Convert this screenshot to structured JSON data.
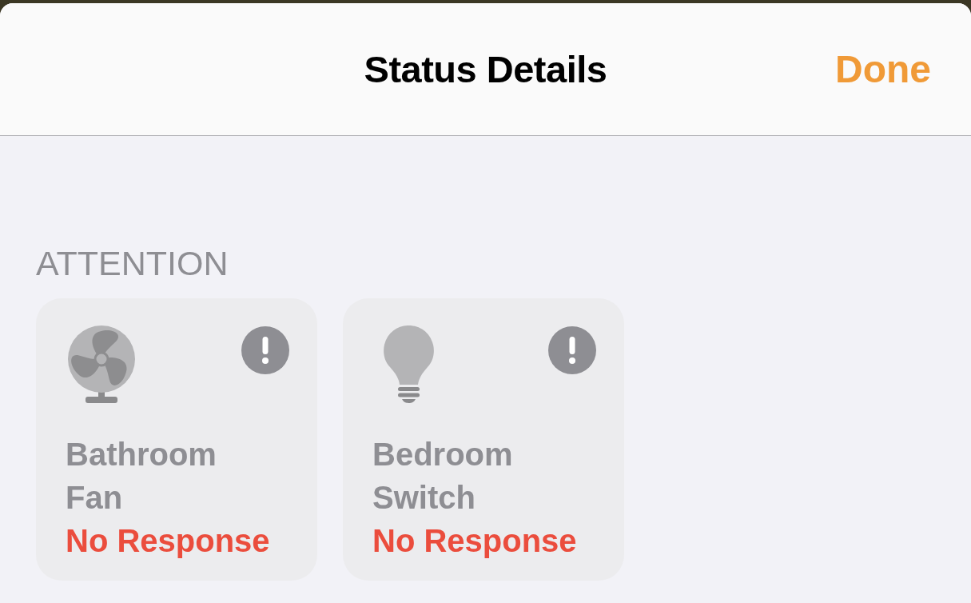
{
  "header": {
    "title": "Status Details",
    "done_label": "Done"
  },
  "section": {
    "title": "ATTENTION"
  },
  "devices": [
    {
      "kind": "fan",
      "name": "Bathroom Fan",
      "status": "No Response",
      "alert": true
    },
    {
      "kind": "bulb",
      "name": "Bedroom Switch",
      "status": "No Response",
      "alert": true
    }
  ]
}
